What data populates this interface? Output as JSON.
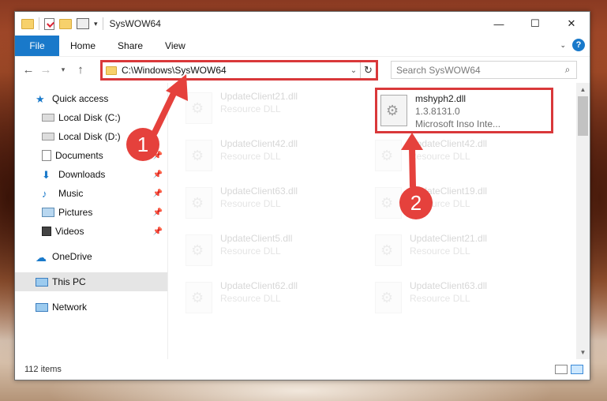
{
  "window": {
    "title": "SysWOW64"
  },
  "ribbon": {
    "file_tab": "File",
    "tabs": [
      "Home",
      "Share",
      "View"
    ]
  },
  "address": {
    "path": "C:\\Windows\\SysWOW64"
  },
  "search": {
    "placeholder": "Search SysWOW64"
  },
  "nav": {
    "quick_access": "Quick access",
    "items": [
      {
        "label": "Local Disk (C:)",
        "icon": "drive-icon",
        "pinned": false
      },
      {
        "label": "Local Disk (D:)",
        "icon": "drive-icon",
        "pinned": false
      },
      {
        "label": "Documents",
        "icon": "documents-icon",
        "pinned": true
      },
      {
        "label": "Downloads",
        "icon": "downloads-icon",
        "pinned": true
      },
      {
        "label": "Music",
        "icon": "music-icon",
        "pinned": true
      },
      {
        "label": "Pictures",
        "icon": "pictures-icon",
        "pinned": true
      },
      {
        "label": "Videos",
        "icon": "videos-icon",
        "pinned": true
      }
    ],
    "onedrive": "OneDrive",
    "this_pc": "This PC",
    "network": "Network"
  },
  "files": [
    {
      "name": "UpdateClient21.dll",
      "meta": "Resource DLL"
    },
    {
      "name": "mshyph2.dll",
      "meta": "1.3.8131.0",
      "meta2": "Microsoft Inso Inte..."
    },
    {
      "name": "UpdateClient42.dll",
      "meta": "Resource DLL"
    },
    {
      "name": "UpdateClient42.dll",
      "meta": "Resource DLL"
    },
    {
      "name": "UpdateClient63.dll",
      "meta": "Resource DLL"
    },
    {
      "name": "UpdateClient19.dll",
      "meta": "Resource DLL"
    },
    {
      "name": "UpdateClient5.dll",
      "meta": "Resource DLL"
    },
    {
      "name": "UpdateClient21.dll",
      "meta": "Resource DLL"
    },
    {
      "name": "UpdateClient62.dll",
      "meta": "Resource DLL"
    },
    {
      "name": "UpdateClient63.dll",
      "meta": "Resource DLL"
    }
  ],
  "status": {
    "count": "112 items"
  },
  "annotations": {
    "badge1": "1",
    "badge2": "2"
  },
  "colors": {
    "accent": "#1979ca",
    "highlight": "#d9383a",
    "badge": "#e5413c"
  }
}
